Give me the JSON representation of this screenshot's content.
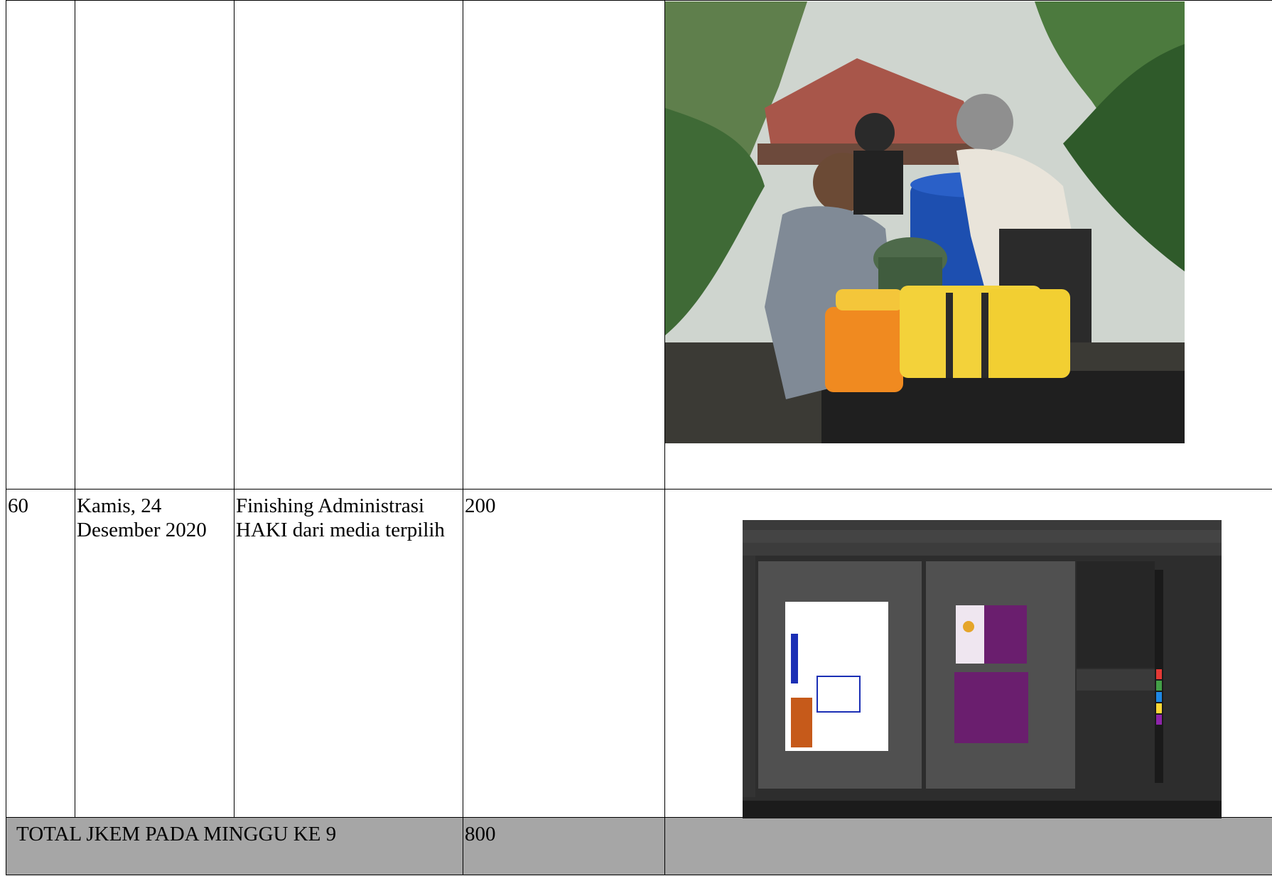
{
  "table": {
    "rows": [
      {
        "no": "",
        "date": "",
        "activity": "",
        "jkem": "",
        "photo": {
          "icon": "field-activity-photo",
          "description_visible": false
        }
      },
      {
        "no": "60",
        "date": "Kamis, 24 Desember 2020",
        "activity": "Finishing Administrasi HAKI dari media terpilih",
        "jkem": "200",
        "photo": {
          "icon": "design-software-screenshot"
        }
      }
    ],
    "total": {
      "label": "TOTAL JKEM PADA MINGGU KE 9",
      "value": "800"
    }
  },
  "colors": {
    "total_row_bg": "#a6a6a6",
    "border": "#000000"
  }
}
